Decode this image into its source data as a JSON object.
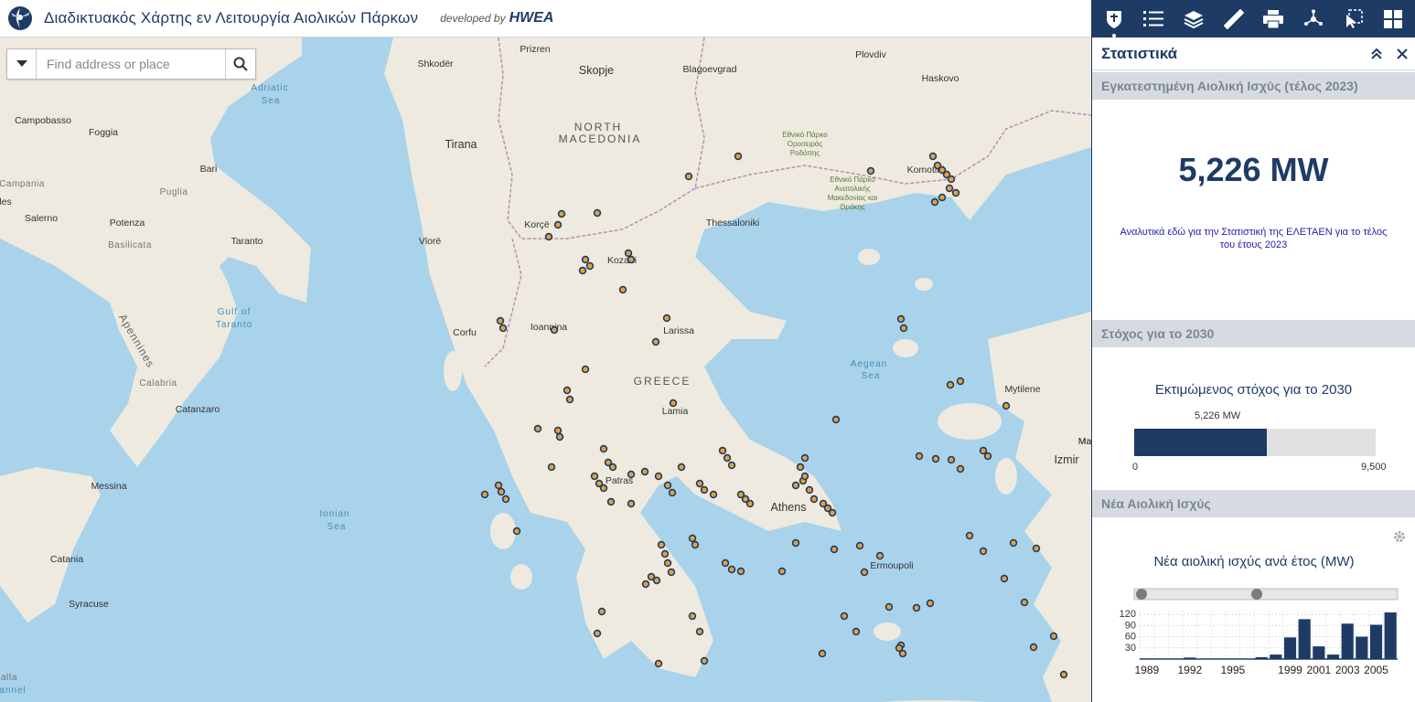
{
  "header": {
    "title": "Διαδικτυακός Χάρτης εν Λειτουργία Αιολικών Πάρκων",
    "developed_by": "developed by",
    "brand": "HWEA"
  },
  "search": {
    "placeholder": "Find address or place"
  },
  "map": {
    "labels": [
      {
        "text": "Shkodër",
        "cls": "city"
      },
      {
        "text": "Prizren",
        "cls": "city"
      },
      {
        "text": "Skopje",
        "cls": "bigcity"
      },
      {
        "text": "Blagoevgrad",
        "cls": "city"
      },
      {
        "text": "Plovdiv",
        "cls": "city"
      },
      {
        "text": "Haskovo",
        "cls": "city"
      },
      {
        "text": "Adriatic",
        "cls": "sea"
      },
      {
        "text": "Sea",
        "cls": "sea"
      },
      {
        "text": "Campobasso",
        "cls": "city"
      },
      {
        "text": "Foggia",
        "cls": "city"
      },
      {
        "text": "Tirana",
        "cls": "bigcity"
      },
      {
        "text": "NORTH",
        "cls": "country"
      },
      {
        "text": "MACEDONIA",
        "cls": "country"
      },
      {
        "text": "Εθνικό Πάρκο",
        "cls": "park"
      },
      {
        "text": "Οροσειράς",
        "cls": "park"
      },
      {
        "text": "Ροδόπης",
        "cls": "park"
      },
      {
        "text": "Bari",
        "cls": "city"
      },
      {
        "text": "Campania",
        "cls": "region"
      },
      {
        "text": "Puglia",
        "cls": "region"
      },
      {
        "text": "Εθνικό Πάρκο",
        "cls": "park"
      },
      {
        "text": "Ανατολικής",
        "cls": "park"
      },
      {
        "text": "Μακεδονίας και",
        "cls": "park"
      },
      {
        "text": "Θράκης",
        "cls": "park"
      },
      {
        "text": "Komotini",
        "cls": "city"
      },
      {
        "text": "Salerno",
        "cls": "city"
      },
      {
        "text": "Potenza",
        "cls": "city"
      },
      {
        "text": "Korçë",
        "cls": "city"
      },
      {
        "text": "Thessaloniki",
        "cls": "city"
      },
      {
        "text": "Basilicata",
        "cls": "region"
      },
      {
        "text": "Taranto",
        "cls": "city"
      },
      {
        "text": "Vlorë",
        "cls": "city"
      },
      {
        "text": "Kozani",
        "cls": "city"
      },
      {
        "text": "Gulf of",
        "cls": "sea"
      },
      {
        "text": "Taranto",
        "cls": "sea"
      },
      {
        "text": "Apennines",
        "cls": "mount"
      },
      {
        "text": "Corfu",
        "cls": "city"
      },
      {
        "text": "Ioannina",
        "cls": "city"
      },
      {
        "text": "Larissa",
        "cls": "city"
      },
      {
        "text": "Aegean",
        "cls": "sea"
      },
      {
        "text": "Sea",
        "cls": "sea"
      },
      {
        "text": "Calabria",
        "cls": "region"
      },
      {
        "text": "GREECE",
        "cls": "country"
      },
      {
        "text": "Mytilene",
        "cls": "city"
      },
      {
        "text": "Catanzaro",
        "cls": "city"
      },
      {
        "text": "Lamia",
        "cls": "city"
      },
      {
        "text": "Izmir",
        "cls": "bigcity"
      },
      {
        "text": "Ma",
        "cls": "city"
      },
      {
        "text": "Messina",
        "cls": "city"
      },
      {
        "text": "Patras",
        "cls": "city"
      },
      {
        "text": "Athens",
        "cls": "bigcity"
      },
      {
        "text": "Ionian",
        "cls": "sea"
      },
      {
        "text": "Sea",
        "cls": "sea"
      },
      {
        "text": "Catania",
        "cls": "city"
      },
      {
        "text": "Ermoupoli",
        "cls": "city"
      },
      {
        "text": "Syracuse",
        "cls": "city"
      },
      {
        "text": "alta",
        "cls": "region"
      },
      {
        "text": "annel",
        "cls": "sea"
      },
      {
        "text": "les",
        "cls": "city"
      },
      {
        "text": "Ma",
        "cls": "city"
      }
    ]
  },
  "toolbar": {
    "items": [
      {
        "name": "legend-logo-tool",
        "icon": "shield-logo-icon",
        "active": true
      },
      {
        "name": "legend-list-tool",
        "icon": "list-icon"
      },
      {
        "name": "layers-tool",
        "icon": "layers-icon"
      },
      {
        "name": "measure-tool",
        "icon": "ruler-icon"
      },
      {
        "name": "print-tool",
        "icon": "printer-icon"
      },
      {
        "name": "share-tool",
        "icon": "share-network-icon"
      },
      {
        "name": "select-tool",
        "icon": "select-cursor-icon"
      },
      {
        "name": "apps-tool",
        "icon": "grid-icon"
      }
    ]
  },
  "panel": {
    "title": "Στατιστικά",
    "sections": {
      "installed": {
        "heading": "Εγκατεστημένη Αιολική Ισχύς (τέλος 2023)",
        "value": "5,226",
        "unit": "MW",
        "link_text": "Αναλυτικά εδώ για την Στατιστική της ΕΛΕΤΑΕΝ για το τέλος του έτους 2023"
      },
      "target": {
        "heading": "Στόχος για το 2030",
        "caption": "Εκτιμώμενος στόχος για το 2030",
        "current_label": "5,226 MW",
        "current": 5226,
        "min_label": "0",
        "max_label": "9,500",
        "max": 9500
      },
      "new_power": {
        "heading": "Νέα Αιολική Ισχύς",
        "chart_title": "Νέα αιολική ισχύς ανά έτος (MW)"
      }
    }
  },
  "colors": {
    "navy": "#1e3b66",
    "wind_dot": "#e5a13a",
    "sea": "#a8d3ea",
    "land": "#f2efe6"
  },
  "chart_data": {
    "type": "bar",
    "title": "Νέα αιολική ισχύς ανά έτος (MW)",
    "categories": [
      "1989",
      "1990",
      "1991",
      "1992",
      "1993",
      "1994",
      "1995",
      "1996",
      "1997",
      "1998",
      "1999",
      "2000",
      "2001",
      "2002",
      "2003",
      "2004",
      "2005",
      "2006"
    ],
    "x_tick_labels": [
      "1989",
      "1992",
      "1995",
      "1999",
      "2001",
      "2003",
      "2005"
    ],
    "y_tick_labels": [
      "120",
      "90",
      "60",
      "30"
    ],
    "values": [
      0,
      0,
      0,
      4,
      0,
      0,
      0,
      0,
      5,
      12,
      58,
      107,
      34,
      12,
      95,
      60,
      92,
      125
    ],
    "ylim": [
      0,
      130
    ],
    "grid": true,
    "xlabel": "",
    "ylabel": ""
  }
}
